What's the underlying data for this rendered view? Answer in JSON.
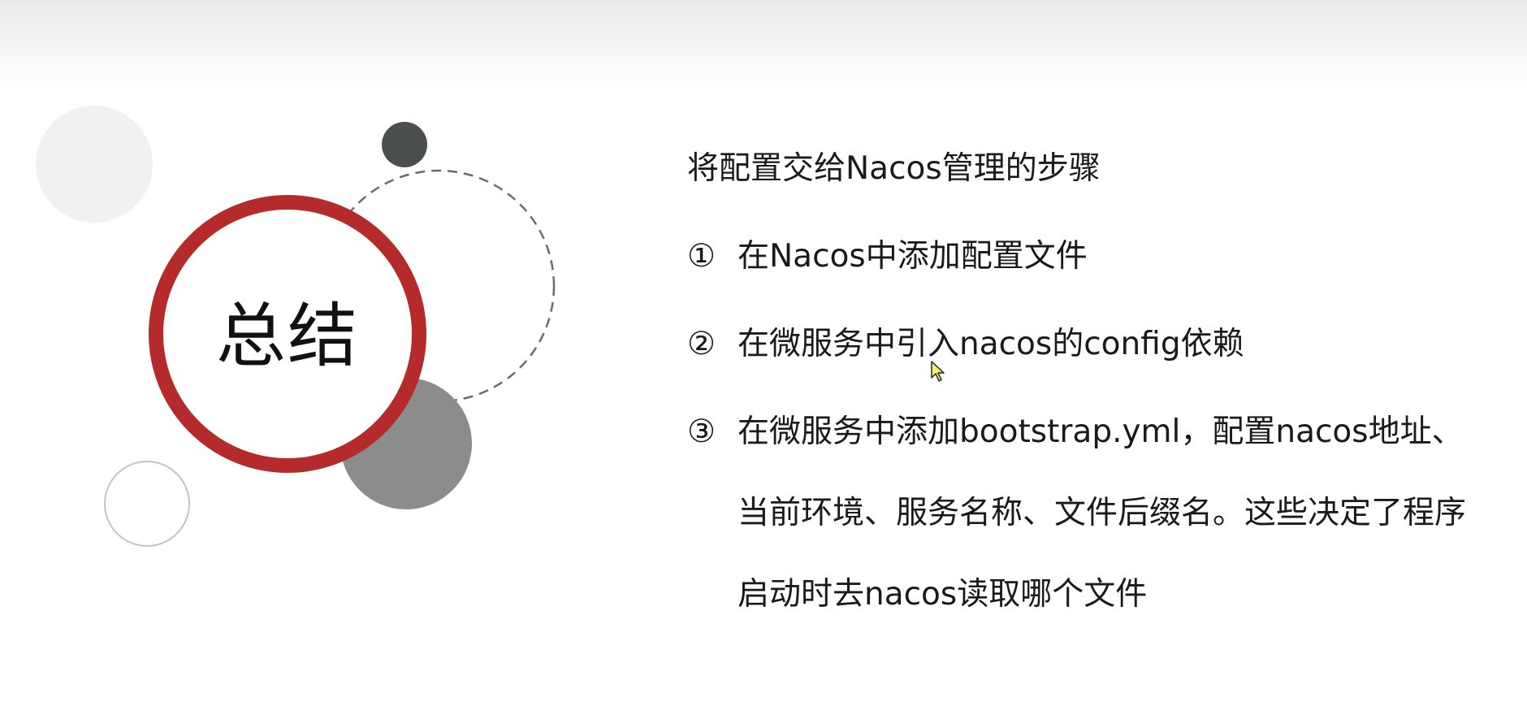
{
  "slide": {
    "title": "总结",
    "subtitle": "将配置交给Nacos管理的步骤",
    "steps": [
      {
        "number": "①",
        "lines": [
          "在Nacos中添加配置文件"
        ]
      },
      {
        "number": "②",
        "lines": [
          "在微服务中引入nacos的config依赖"
        ]
      },
      {
        "number": "③",
        "lines": [
          "在微服务中添加bootstrap.yml，配置nacos地址、",
          "当前环境、服务名称、文件后缀名。这些决定了程序",
          "启动时去nacos读取哪个文件"
        ]
      }
    ]
  },
  "colors": {
    "accent_red": "#b52a2a",
    "dark_gray": "#4a4e4c",
    "mid_gray": "#8c8c8c",
    "light_gray": "#f1f1ef"
  }
}
